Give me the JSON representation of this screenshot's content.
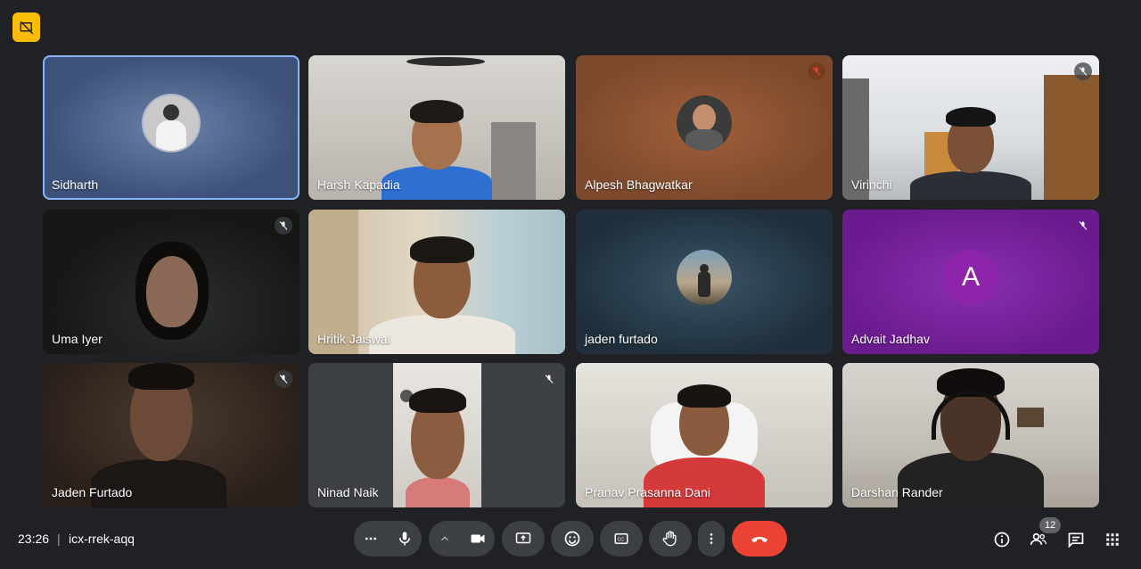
{
  "meeting": {
    "time": "23:26",
    "separator": "|",
    "code": "icx-rrek-aqq"
  },
  "participants": [
    {
      "name": "Sidharth",
      "muted": false,
      "active": true,
      "mode": "avatar-photo"
    },
    {
      "name": "Harsh Kapadia",
      "muted": false,
      "active": false,
      "mode": "video"
    },
    {
      "name": "Alpesh Bhagwatkar",
      "muted": true,
      "active": false,
      "mode": "avatar-photo"
    },
    {
      "name": "Virinchi",
      "muted": true,
      "active": false,
      "mode": "video"
    },
    {
      "name": "Uma Iyer",
      "muted": true,
      "active": false,
      "mode": "video"
    },
    {
      "name": "Hritik Jaiswal",
      "muted": false,
      "active": false,
      "mode": "video"
    },
    {
      "name": "jaden furtado",
      "muted": false,
      "active": false,
      "mode": "avatar-photo"
    },
    {
      "name": "Advait Jadhav",
      "muted": true,
      "active": false,
      "mode": "avatar-letter",
      "initial": "A"
    },
    {
      "name": "Jaden Furtado",
      "muted": true,
      "active": false,
      "mode": "video"
    },
    {
      "name": "Ninad Naik",
      "muted": true,
      "active": false,
      "mode": "video"
    },
    {
      "name": "Pranav Prasanna Dani",
      "muted": false,
      "active": false,
      "mode": "video"
    },
    {
      "name": "Darshan Rander",
      "muted": false,
      "active": false,
      "mode": "video"
    }
  ],
  "participant_count": "12",
  "icons": {
    "top_left": "presentation-off-icon",
    "controls": [
      "more-options-icon",
      "microphone-icon",
      "chevron-up-icon",
      "camera-icon",
      "present-screen-icon",
      "emoji-icon",
      "captions-icon",
      "raise-hand-icon",
      "more-vert-icon",
      "end-call-icon"
    ],
    "right": [
      "info-icon",
      "people-icon",
      "chat-icon",
      "activities-icon"
    ]
  },
  "colors": {
    "background": "#202124",
    "control_bg": "#3c4043",
    "end_call": "#ea4335",
    "active_border": "#8ab4f8",
    "badge_yellow": "#fbbc04",
    "advait_tile": "#7b1fa2"
  }
}
